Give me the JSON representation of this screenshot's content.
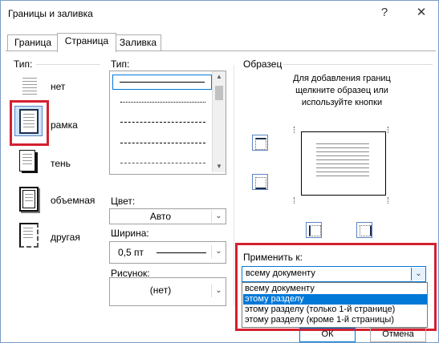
{
  "window": {
    "title": "Границы и заливка",
    "help_glyph": "?",
    "close_glyph": "✕"
  },
  "tabs": [
    "Граница",
    "Страница",
    "Заливка"
  ],
  "type_section": {
    "label": "Тип:",
    "presets": [
      "нет",
      "рамка",
      "тень",
      "объемная",
      "другая"
    ]
  },
  "style_section": {
    "label": "Тип:"
  },
  "color": {
    "label": "Цвет:",
    "value": "Авто"
  },
  "width": {
    "label": "Ширина:",
    "value": "0,5 пт"
  },
  "art": {
    "label": "Рисунок:",
    "value": "(нет)"
  },
  "preview": {
    "label": "Образец",
    "instructions": "Для добавления границ щелкните образец или используйте кнопки"
  },
  "apply_to": {
    "label": "Применить к:",
    "value": "всему документу",
    "options": [
      "всему документу",
      "этому разделу",
      "этому разделу (только 1-й странице)",
      "этому разделу (кроме 1-й страницы)"
    ],
    "highlighted_index": 1
  },
  "footer": {
    "ok_label": "ОК",
    "cancel_label": "Отмена"
  },
  "colors": {
    "accent": "#0078d7",
    "highlight_box": "#d3202f"
  }
}
